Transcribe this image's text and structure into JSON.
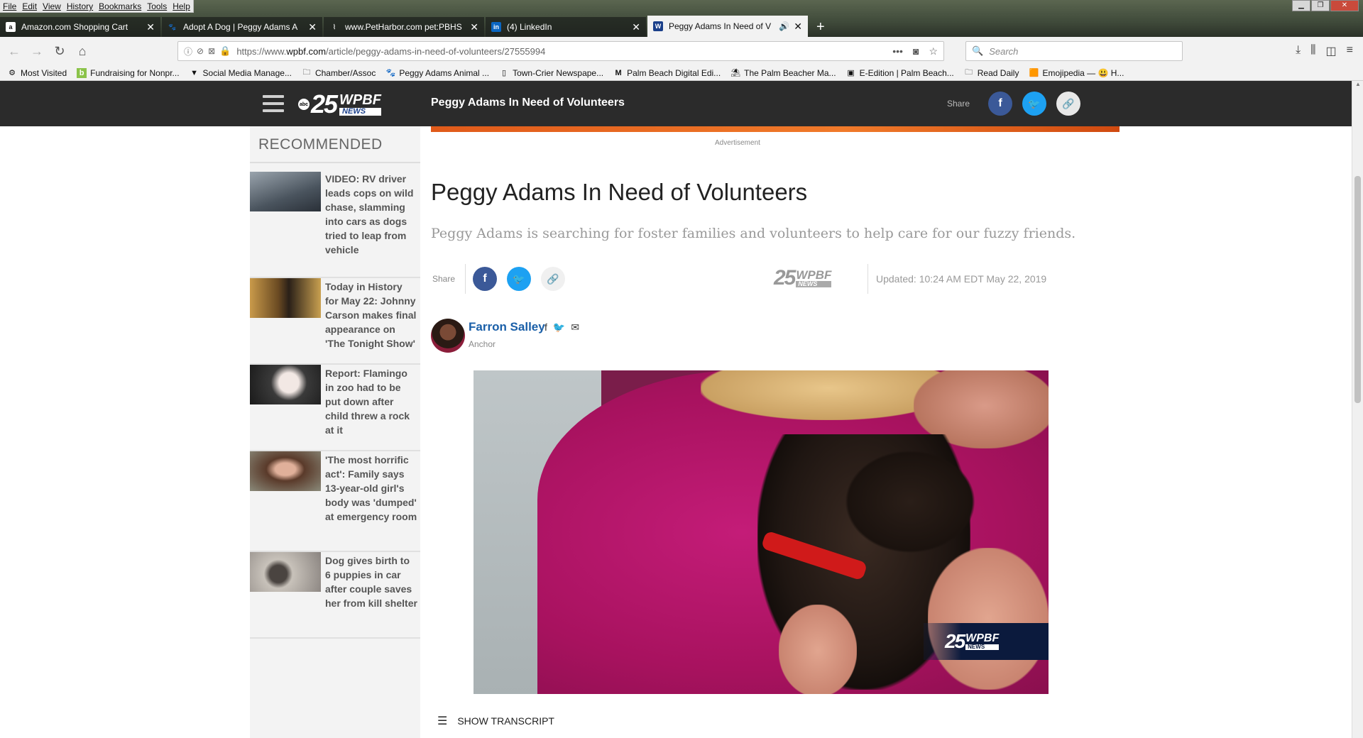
{
  "browser": {
    "menu": [
      "File",
      "Edit",
      "View",
      "History",
      "Bookmarks",
      "Tools",
      "Help"
    ],
    "tabs": [
      {
        "label": "Amazon.com Shopping Cart",
        "icon": "amazon-icon"
      },
      {
        "label": "Adopt A Dog | Peggy Adams A",
        "icon": "paw-icon"
      },
      {
        "label": "www.PetHarbor.com pet:PBHS",
        "icon": "petharbor-icon"
      },
      {
        "label": "(4) LinkedIn",
        "icon": "linkedin-icon"
      },
      {
        "label": "Peggy Adams In Need of V",
        "icon": "wpbf-icon",
        "active": true
      }
    ],
    "url_prefix": "https://www.",
    "url_domain": "wpbf.com",
    "url_path": "/article/peggy-adams-in-need-of-volunteers/27555994",
    "search_placeholder": "Search",
    "bookmarks": [
      {
        "label": "Most Visited",
        "icon": "gear-icon"
      },
      {
        "label": "Fundraising for Nonpr...",
        "icon": "b-icon"
      },
      {
        "label": "Social Media Manage...",
        "icon": "bookmark-icon"
      },
      {
        "label": "Chamber/Assoc",
        "icon": "folder-icon"
      },
      {
        "label": "Peggy Adams Animal ...",
        "icon": "paw-icon"
      },
      {
        "label": "Town-Crier Newspape...",
        "icon": "page-icon"
      },
      {
        "label": "Palm Beach Digital Edi...",
        "icon": "m-icon"
      },
      {
        "label": "The Palm Beacher Ma...",
        "icon": "beacher-icon"
      },
      {
        "label": "E-Edition | Palm Beach...",
        "icon": "edition-icon"
      },
      {
        "label": "Read Daily",
        "icon": "folder-icon"
      },
      {
        "label": "Emojipedia — 😃 H...",
        "icon": "emojipedia-icon"
      }
    ]
  },
  "site": {
    "logo_number": "25",
    "logo_brand": "WPBF",
    "logo_news": "NEWS",
    "logo_abc": "abc",
    "header_title": "Peggy Adams In Need of Volunteers",
    "header_share": "Share"
  },
  "sidebar": {
    "title": "RECOMMENDED",
    "items": [
      {
        "text": "VIDEO: RV driver leads cops on wild chase, slamming into cars as dogs tried to leap from vehicle",
        "thumb_color": "#6a7480"
      },
      {
        "text": "Today in History for May 22: Johnny Carson makes final appearance on 'The Tonight Show'",
        "thumb_color": "#8a6a3a"
      },
      {
        "text": "Report: Flamingo in zoo had to be put down after child threw a rock at it",
        "thumb_color": "#4a4a4a"
      },
      {
        "text": "'The most horrific act': Family says 13-year-old girl's body was 'dumped' at emergency room",
        "thumb_color": "#7a5a4a"
      },
      {
        "text": "Dog gives birth to 6 puppies in car after couple saves her from kill shelter",
        "thumb_color": "#9a9288"
      }
    ]
  },
  "article": {
    "ad_label": "Advertisement",
    "title": "Peggy Adams In Need of Volunteers",
    "subtitle": "Peggy Adams is searching for foster families and volunteers to help care for our fuzzy friends.",
    "share_label": "Share",
    "updated": "Updated: 10:24 AM EDT May 22, 2019",
    "author_name": "Farron Salley",
    "author_role": "Anchor",
    "transcript_label": "SHOW TRANSCRIPT"
  }
}
